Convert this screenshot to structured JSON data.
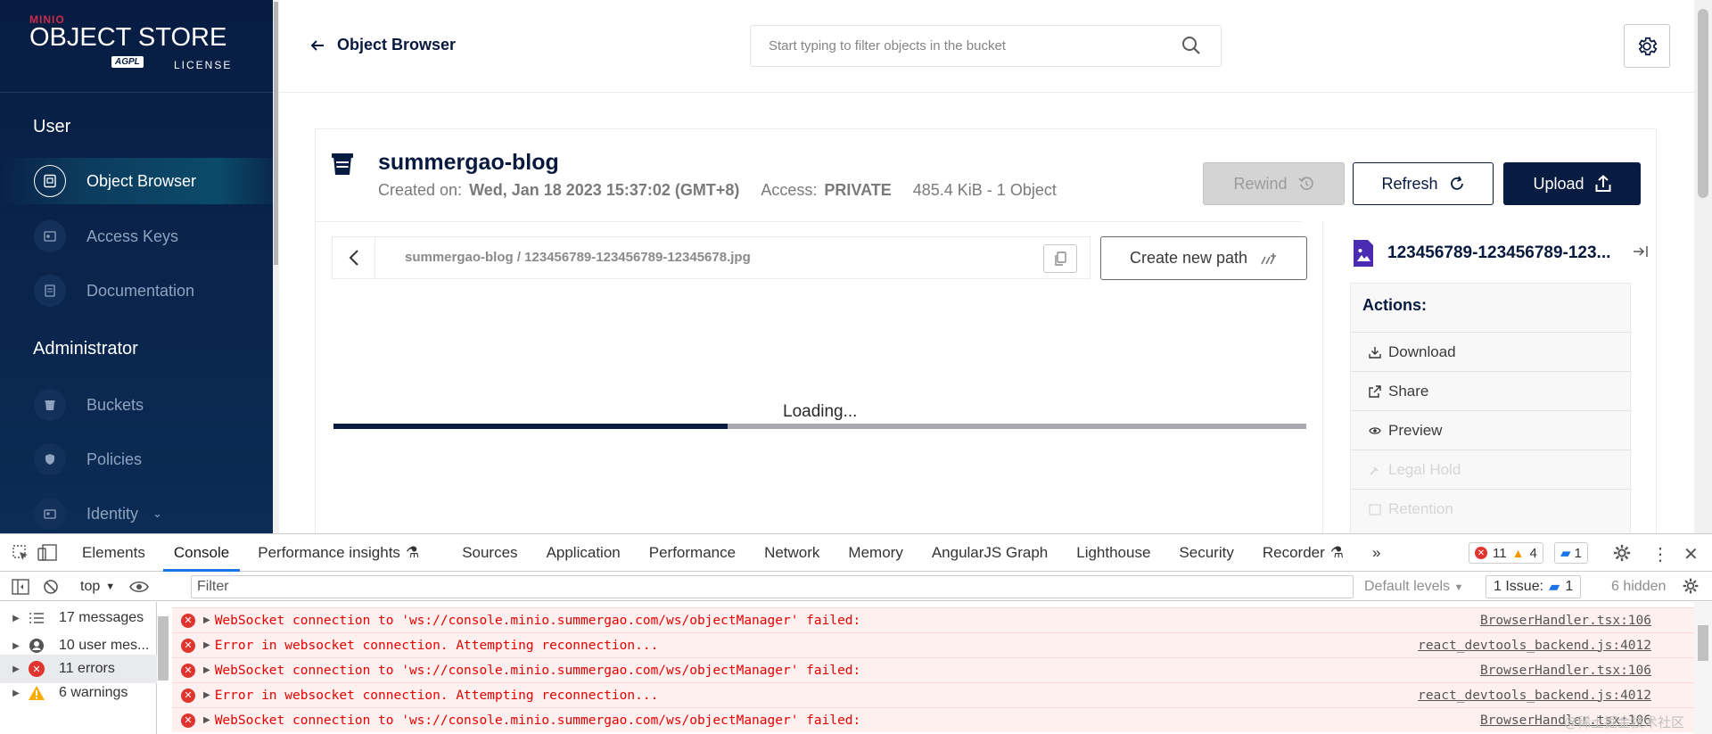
{
  "sidebar": {
    "logo": {
      "brand": "MINIO",
      "product": "OBJECT STORE",
      "agpl": "AGPL",
      "license": "LICENSE"
    },
    "sections": [
      {
        "title": "User",
        "items": [
          {
            "label": "Object Browser",
            "icon": "object-browser-icon",
            "active": true
          },
          {
            "label": "Access Keys",
            "icon": "access-keys-icon"
          },
          {
            "label": "Documentation",
            "icon": "documentation-icon"
          }
        ]
      },
      {
        "title": "Administrator",
        "items": [
          {
            "label": "Buckets",
            "icon": "bucket-icon"
          },
          {
            "label": "Policies",
            "icon": "policy-icon"
          },
          {
            "label": "Identity",
            "icon": "identity-icon"
          }
        ]
      }
    ]
  },
  "header": {
    "title": "Object Browser",
    "search_placeholder": "Start typing to filter objects in the bucket"
  },
  "bucket": {
    "name": "summergao-blog",
    "created_label": "Created on:",
    "created_value": "Wed, Jan 18 2023 15:37:02 (GMT+8)",
    "access_label": "Access:",
    "access_value": "PRIVATE",
    "size_summary": "485.4 KiB - 1 Object",
    "buttons": {
      "rewind": "Rewind",
      "refresh": "Refresh",
      "upload": "Upload"
    }
  },
  "browser": {
    "breadcrumb": "summergao-blog  /  123456789-123456789-12345678.jpg",
    "create_path": "Create new path",
    "loading": "Loading...",
    "progress": 0.405
  },
  "detail": {
    "filename": "123456789-123456789-123...",
    "actions_title": "Actions:",
    "actions": [
      {
        "label": "Download",
        "icon": "download-icon",
        "enabled": true
      },
      {
        "label": "Share",
        "icon": "share-icon",
        "enabled": true
      },
      {
        "label": "Preview",
        "icon": "eye-icon",
        "enabled": true
      },
      {
        "label": "Legal Hold",
        "icon": "legal-hold-icon",
        "enabled": false
      },
      {
        "label": "Retention",
        "icon": "retention-icon",
        "enabled": false
      }
    ]
  },
  "devtools": {
    "tabs": [
      "Elements",
      "Console",
      "Performance insights",
      "Sources",
      "Application",
      "Performance",
      "Network",
      "Memory",
      "AngularJS Graph",
      "Lighthouse",
      "Security",
      "Recorder"
    ],
    "active_tab": "Console",
    "error_count": "11",
    "warning_count": "4",
    "message_count": "1",
    "context": "top",
    "filter_placeholder": "Filter",
    "levels": "Default levels",
    "issues": "1 Issue:",
    "issues_count": "1",
    "hidden": "6 hidden",
    "sidebar": [
      {
        "label": "17 messages",
        "icon": "list-icon"
      },
      {
        "label": "10 user mes...",
        "icon": "user-icon"
      },
      {
        "label": "11 errors",
        "icon": "error-icon"
      },
      {
        "label": "6 warnings",
        "icon": "warning-icon"
      }
    ],
    "logs": [
      {
        "text": "WebSocket connection to 'ws://console.minio.summergao.com/ws/objectManager' failed:",
        "source": "BrowserHandler.tsx:106"
      },
      {
        "text": "Error in websocket connection. Attempting reconnection...",
        "source": "react_devtools_backend.js:4012"
      },
      {
        "text": "WebSocket connection to 'ws://console.minio.summergao.com/ws/objectManager' failed:",
        "source": "BrowserHandler.tsx:106"
      },
      {
        "text": "Error in websocket connection. Attempting reconnection...",
        "source": "react_devtools_backend.js:4012"
      },
      {
        "text": "WebSocket connection to 'ws://console.minio.summergao.com/ws/objectManager' failed:",
        "source": "BrowserHandler.tsx:106"
      }
    ],
    "watermark": "@稀土掘金技术社区"
  },
  "colors": {
    "navy": "#081c42",
    "error": "#e50000",
    "accent": "#1a73e8"
  }
}
